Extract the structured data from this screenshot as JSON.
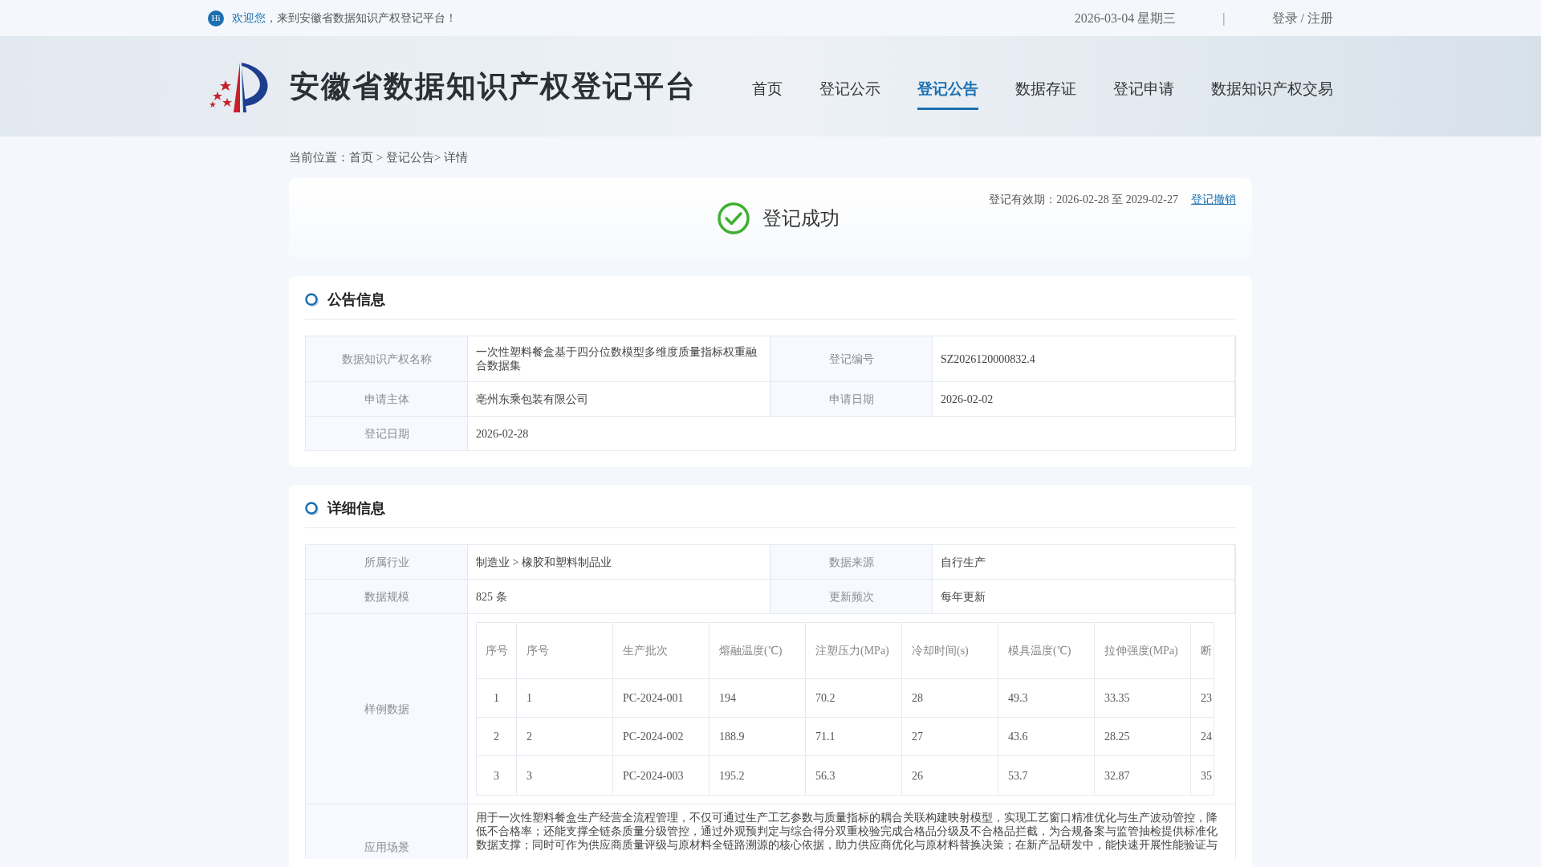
{
  "top_bar": {
    "badge": "Hi",
    "greeting": "欢迎您",
    "welcome": "，来到安徽省数据知识产权登记平台！",
    "date": "2026-03-04 星期三",
    "separator": "|",
    "login": "登录 / 注册"
  },
  "header": {
    "title": "安徽省数据知识产权登记平台",
    "nav": [
      {
        "label": "首页",
        "selected": false
      },
      {
        "label": "登记公示",
        "selected": false
      },
      {
        "label": "登记公告",
        "selected": true
      },
      {
        "label": "数据存证",
        "selected": false
      },
      {
        "label": "登记申请",
        "selected": false
      },
      {
        "label": "数据知识产权交易",
        "selected": false
      }
    ]
  },
  "breadcrumb": "当前位置：首页 > 登记公告> 详情",
  "status": {
    "text": "登记成功",
    "validity": "登记有效期：2026-02-28 至 2029-02-27",
    "revoke_link": "登记撤销"
  },
  "announcement": {
    "title": "公告信息",
    "rows": [
      [
        {
          "label": "数据知识产权名称",
          "value": "一次性塑料餐盒基于四分位数模型多维度质量指标权重融合数据集"
        },
        {
          "label": "登记编号",
          "value": "SZ2026120000832.4"
        }
      ],
      [
        {
          "label": "申请主体",
          "value": "亳州东乘包装有限公司"
        },
        {
          "label": "申请日期",
          "value": "2026-02-02"
        }
      ],
      [
        {
          "label": "登记日期",
          "value": "2026-02-28"
        }
      ]
    ]
  },
  "details": {
    "title": "详细信息",
    "rows": [
      [
        {
          "label": "所属行业",
          "value": "制造业 > 橡胶和塑料制品业"
        },
        {
          "label": "数据来源",
          "value": "自行生产"
        }
      ],
      [
        {
          "label": "数据规模",
          "value": "825 条"
        },
        {
          "label": "更新频次",
          "value": "每年更新"
        }
      ]
    ],
    "sample": {
      "label": "样例数据",
      "columns": [
        "序号",
        "序号",
        "生产批次",
        "熔融温度(℃)",
        "注塑压力(MPa)",
        "冷却时间(s)",
        "模具温度(℃)",
        "拉伸强度(MPa)",
        "断"
      ],
      "rows": [
        [
          "1",
          "1",
          "PC-2024-001",
          "194",
          "70.2",
          "28",
          "49.3",
          "33.35",
          "23"
        ],
        [
          "2",
          "2",
          "PC-2024-002",
          "188.9",
          "71.1",
          "27",
          "43.6",
          "28.25",
          "24"
        ],
        [
          "3",
          "3",
          "PC-2024-003",
          "195.2",
          "56.3",
          "26",
          "53.7",
          "32.87",
          "35"
        ]
      ]
    },
    "usage": {
      "label": "应用场景",
      "text": "用于一次性塑料餐盒生产经营全流程管理，不仅可通过生产工艺参数与质量指标的耦合关联构建映射模型，实现工艺窗口精准优化与生产波动管控，降低不合格率；还能支撑全链条质量分级管控，通过外观预判定与综合得分双重校验完成合格品分级及不合格品拦截，为合规备案与监管抽检提供标准化数据支撑；同时可作为供应商质量评级与原材料全链路溯源的核心依据，助力供应商优化与原材料替换决策；在新产品研发中，能快速开展性能验证与"
    }
  }
}
